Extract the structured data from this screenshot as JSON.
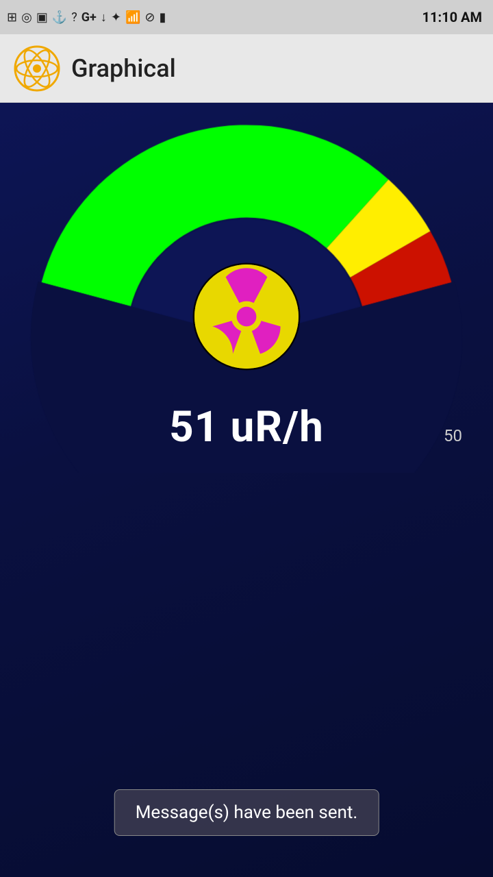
{
  "statusBar": {
    "time": "11:10 AM",
    "icons": [
      "＋",
      "◉",
      "▣",
      "⚓",
      "?",
      "G+",
      "↓",
      "✦",
      "📶",
      "⊘",
      "🔋"
    ]
  },
  "appBar": {
    "title": "Graphical"
  },
  "gauge": {
    "value": "51",
    "unit": "uR/h",
    "reading": "51 uR/h",
    "scaleLabel": "50",
    "colors": {
      "green": "#00ff00",
      "yellow": "#ffee00",
      "red": "#dd1111",
      "background": "#0d1555"
    }
  },
  "toast": {
    "message": "Message(s) have been sent."
  }
}
